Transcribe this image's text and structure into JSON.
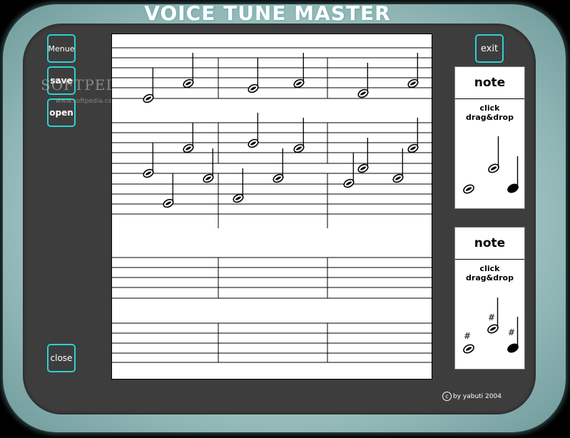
{
  "app": {
    "title": "VOICE TUNE MASTER"
  },
  "sidebar": {
    "menu_label": "Menue",
    "save_label": "save",
    "open_label": "open",
    "close_label": "close"
  },
  "exit_label": "exit",
  "watermark": {
    "brand": "SOFTPEDIA",
    "url": "www.softpedia.com"
  },
  "palettes": [
    {
      "title": "note",
      "hint": "click drag&drop",
      "items": [
        "whole-note",
        "half-note",
        "quarter-note"
      ]
    },
    {
      "title": "note",
      "hint": "click drag&drop",
      "items": [
        "sharp-whole-note",
        "sharp-half-note",
        "sharp-quarter-note"
      ],
      "accidental": "#"
    }
  ],
  "copyright": {
    "symbol": "c",
    "text": "by yabuti 2004"
  },
  "colors": {
    "accent": "#2fd0d0",
    "panel": "#3d3d3d",
    "frame": "#a4c6c6"
  }
}
